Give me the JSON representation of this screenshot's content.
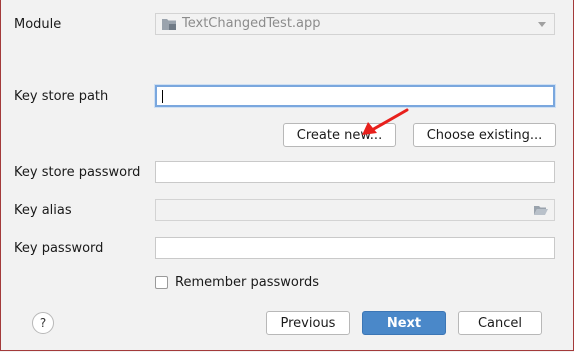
{
  "module": {
    "label": "Module",
    "value": "TextChangedTest.app"
  },
  "key_store_path": {
    "label": "Key store path",
    "value": ""
  },
  "key_store_buttons": {
    "create_new": "Create new...",
    "choose_existing": "Choose existing..."
  },
  "key_store_password": {
    "label": "Key store password",
    "value": ""
  },
  "key_alias": {
    "label": "Key alias",
    "value": ""
  },
  "key_password": {
    "label": "Key password",
    "value": ""
  },
  "remember": {
    "label": "Remember passwords",
    "checked": false
  },
  "footer": {
    "help": "?",
    "previous": "Previous",
    "next": "Next",
    "cancel": "Cancel"
  },
  "colors": {
    "primary_button": "#4a88c9",
    "annotation_arrow": "#e8201c",
    "focus_border": "#7aa7de"
  }
}
